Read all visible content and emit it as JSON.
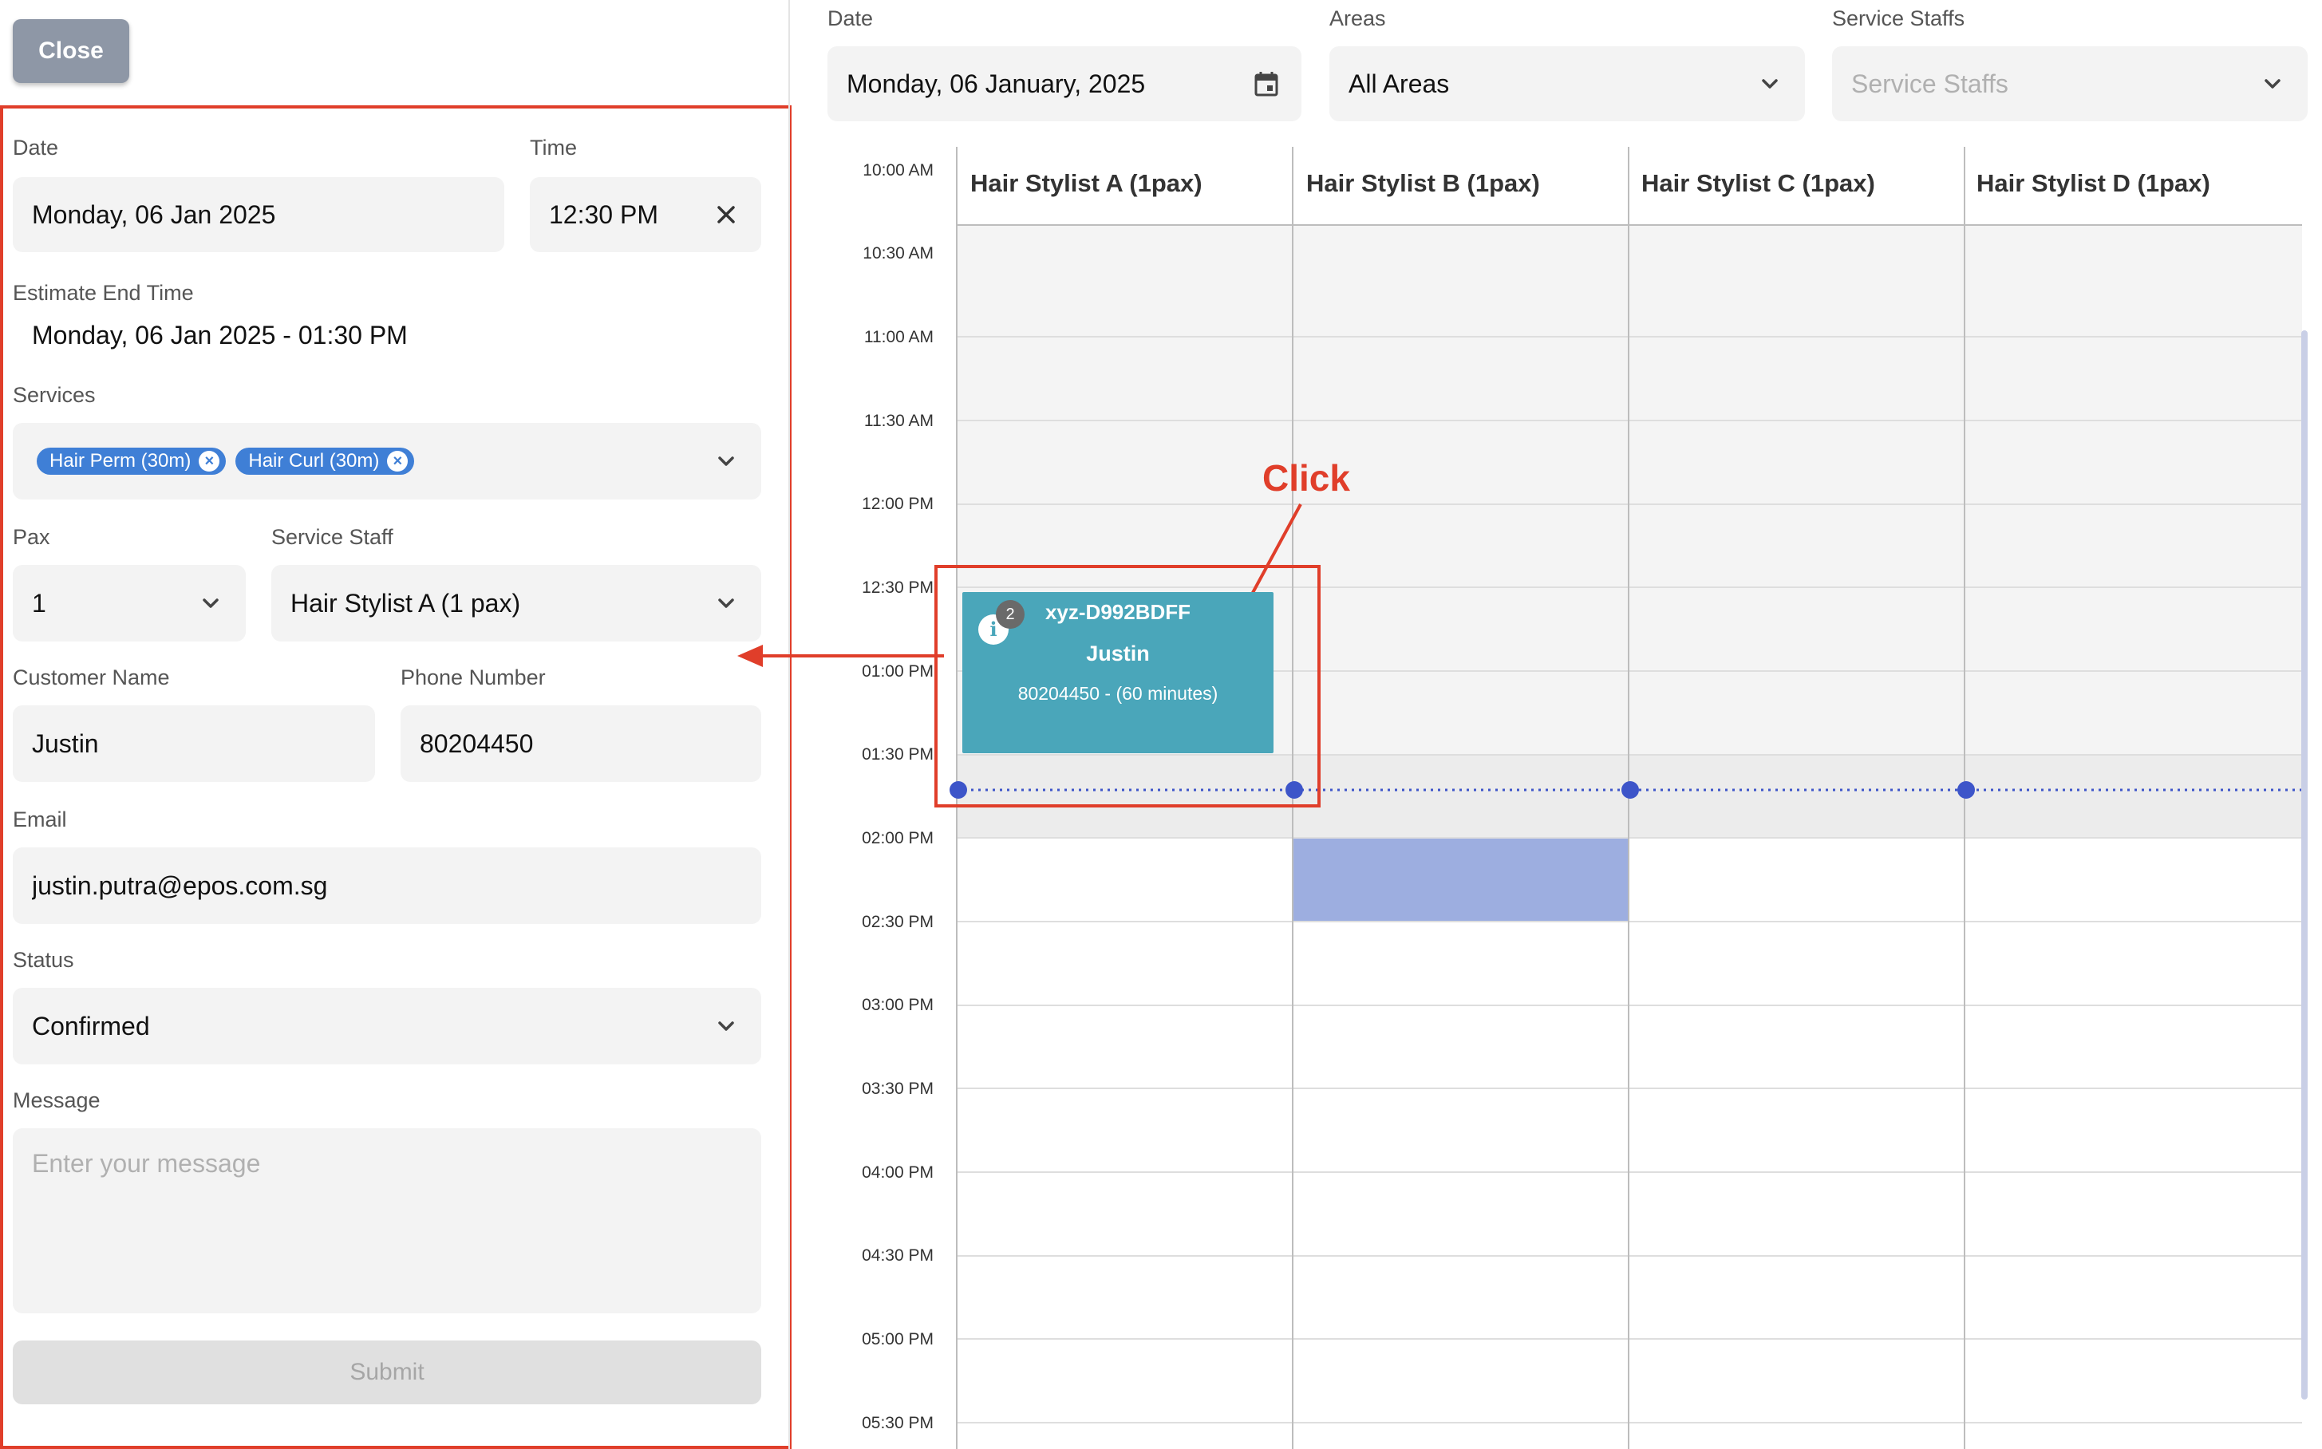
{
  "form": {
    "close_label": "Close",
    "date_label": "Date",
    "date_value": "Monday, 06 Jan 2025",
    "time_label": "Time",
    "time_value": "12:30 PM",
    "estimate_label": "Estimate End Time",
    "estimate_value": "Monday, 06 Jan 2025 - 01:30 PM",
    "services_label": "Services",
    "services": [
      {
        "label": "Hair Perm (30m)"
      },
      {
        "label": "Hair Curl (30m)"
      }
    ],
    "pax_label": "Pax",
    "pax_value": "1",
    "staff_label": "Service Staff",
    "staff_value": "Hair Stylist A (1 pax)",
    "customer_label": "Customer Name",
    "customer_value": "Justin",
    "phone_label": "Phone Number",
    "phone_value": "80204450",
    "email_label": "Email",
    "email_value": "justin.putra@epos.com.sg",
    "status_label": "Status",
    "status_value": "Confirmed",
    "message_label": "Message",
    "message_placeholder": "Enter your message",
    "submit_label": "Submit"
  },
  "filters": {
    "date_label": "Date",
    "date_value": "Monday, 06 January, 2025",
    "areas_label": "Areas",
    "areas_value": "All Areas",
    "staffs_label": "Service Staffs",
    "staffs_placeholder": "Service Staffs"
  },
  "schedule": {
    "columns": [
      {
        "label": "Hair Stylist A (1pax)"
      },
      {
        "label": "Hair Stylist B (1pax)"
      },
      {
        "label": "Hair Stylist C (1pax)"
      },
      {
        "label": "Hair Stylist D (1pax)"
      }
    ],
    "times": [
      "10:00 AM",
      "10:30 AM",
      "11:00 AM",
      "11:30 AM",
      "12:00 PM",
      "12:30 PM",
      "01:00 PM",
      "01:30 PM",
      "02:00 PM",
      "02:30 PM",
      "03:00 PM",
      "03:30 PM",
      "04:00 PM",
      "04:30 PM",
      "05:00 PM",
      "05:30 PM"
    ],
    "appointment": {
      "badge": "2",
      "info_icon": "i",
      "code": "xyz-D992BDFF",
      "name": "Justin",
      "detail": "80204450 - (60 minutes)"
    }
  },
  "annotation": {
    "click_label": "Click"
  },
  "colors": {
    "accent_red": "#e03e2a",
    "appointment": "#4aa6ba",
    "chip": "#3f7fd6",
    "busy_block": "#9daee0",
    "now_line": "#3d55c9"
  }
}
